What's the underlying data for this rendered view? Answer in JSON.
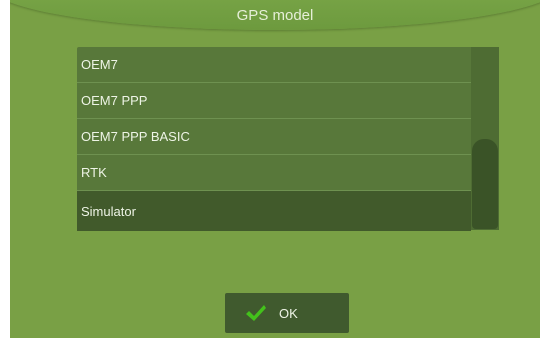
{
  "dialog": {
    "title": "GPS model",
    "ok_label": "OK"
  },
  "list": {
    "items": [
      {
        "label": "OEM7",
        "selected": false
      },
      {
        "label": "OEM7 PPP",
        "selected": false
      },
      {
        "label": "OEM7 PPP BASIC",
        "selected": false
      },
      {
        "label": "RTK",
        "selected": false
      },
      {
        "label": "Simulator",
        "selected": true
      }
    ],
    "scroll_position": 1.0
  },
  "icons": {
    "ok": "checkmark-icon"
  },
  "colors": {
    "background": "#79a045",
    "list_background": "#58783a",
    "selected_row": "#415a2b",
    "button_background": "#405a2e",
    "checkmark": "#43c21b",
    "text": "#eef4e6"
  }
}
